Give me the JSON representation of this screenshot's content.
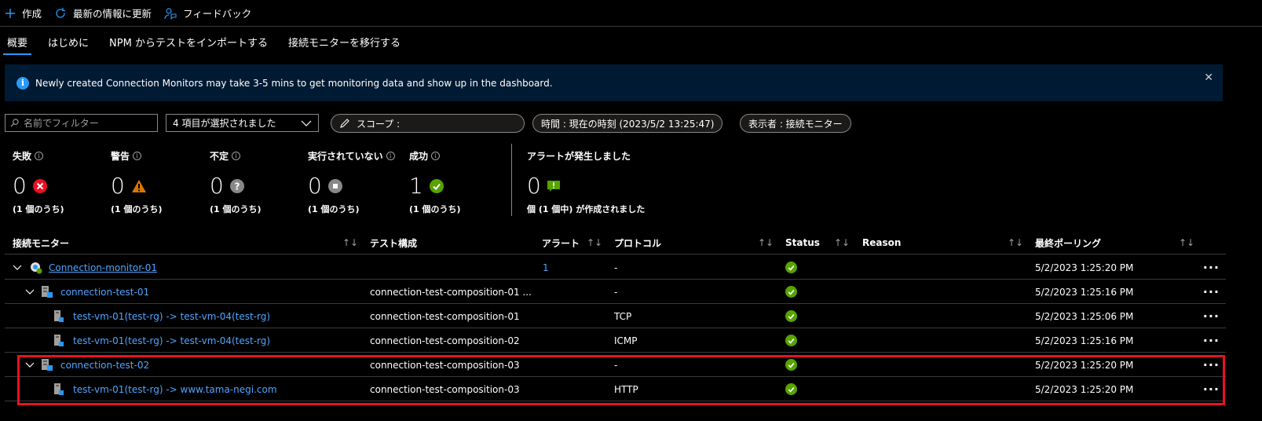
{
  "toolbar": {
    "create": "作成",
    "refresh": "最新の情報に更新",
    "feedback": "フィードバック"
  },
  "tabs": [
    "概要",
    "はじめに",
    "NPM からテストをインポートする",
    "接続モニターを移行する"
  ],
  "banner": {
    "text": "Newly created Connection Monitors may take 3-5 mins to get monitoring data and show up in the dashboard."
  },
  "filters": {
    "name_placeholder": "名前でフィルター",
    "selected": "4 項目が選択されました",
    "scope_label": "スコープ :",
    "time": "時間 : 現在の時刻 (2023/5/2 13:25:47)",
    "viewer": "表示者 : 接続モニター"
  },
  "stats": [
    {
      "label": "失敗",
      "value": "0",
      "sub": "(1 個のうち)",
      "icon": "error-icon"
    },
    {
      "label": "警告",
      "value": "0",
      "sub": "(1 個のうち)",
      "icon": "warning-icon"
    },
    {
      "label": "不定",
      "value": "0",
      "sub": "(1 個のうち)",
      "icon": "unknown-icon"
    },
    {
      "label": "実行されていない",
      "value": "0",
      "sub": "(1 個のうち)",
      "icon": "stopped-icon"
    },
    {
      "label": "成功",
      "value": "1",
      "sub": "(1 個のうち)",
      "icon": "success-icon"
    }
  ],
  "alerts": {
    "label": "アラートが発生しました",
    "value": "0",
    "sub": "個 (1 個中) が作成されました"
  },
  "columns": [
    "接続モニター",
    "テスト構成",
    "アラート",
    "プロトコル",
    "Status",
    "Reason",
    "最終ポーリング"
  ],
  "rows": [
    {
      "name": "Connection-monitor-01",
      "composition": "",
      "alerts": "1",
      "protocol": "-",
      "last": "5/2/2023 1:25:20 PM"
    },
    {
      "name": "connection-test-01",
      "composition": "connection-test-composition-01 ...",
      "alerts": "",
      "protocol": "-",
      "last": "5/2/2023 1:25:16 PM"
    },
    {
      "name": "test-vm-01(test-rg) -> test-vm-04(test-rg)",
      "composition": "connection-test-composition-01",
      "alerts": "",
      "protocol": "TCP",
      "last": "5/2/2023 1:25:06 PM"
    },
    {
      "name": "test-vm-01(test-rg) -> test-vm-04(test-rg)",
      "composition": "connection-test-composition-02",
      "alerts": "",
      "protocol": "ICMP",
      "last": "5/2/2023 1:25:16 PM"
    },
    {
      "name": "connection-test-02",
      "composition": "connection-test-composition-03",
      "alerts": "",
      "protocol": "-",
      "last": "5/2/2023 1:25:20 PM"
    },
    {
      "name": "test-vm-01(test-rg) -> www.tama-negi.com",
      "composition": "connection-test-composition-03",
      "alerts": "",
      "protocol": "HTTP",
      "last": "5/2/2023 1:25:20 PM"
    }
  ],
  "more_label": "···",
  "colors": {
    "accent": "#2899f5",
    "success": "#57a300",
    "error": "#e81123",
    "warning": "#db7500",
    "highlight": "#e81123"
  }
}
